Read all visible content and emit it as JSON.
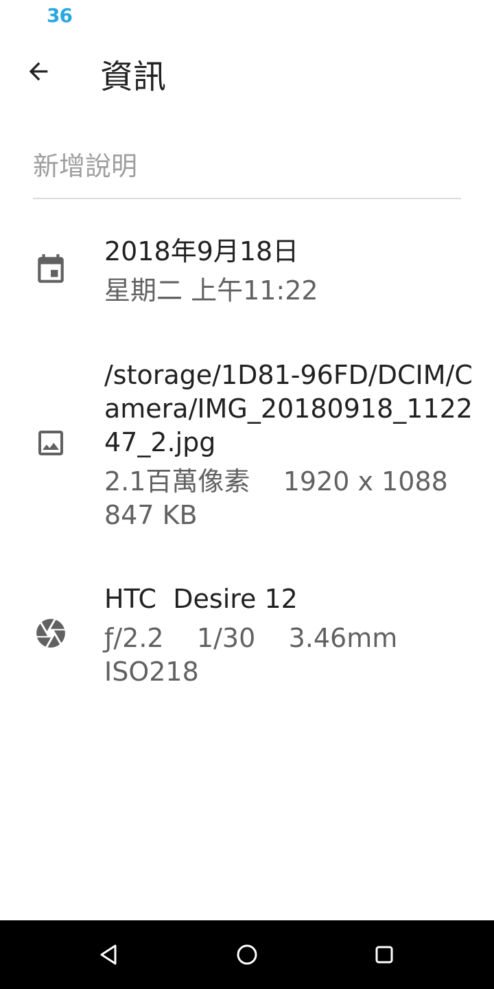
{
  "status_bar": {
    "badge": "36",
    "badge_color": "#29a8e0"
  },
  "app_bar": {
    "back_icon": "arrow-back-icon",
    "title": "資訊"
  },
  "description": {
    "placeholder": "新增說明",
    "value": ""
  },
  "details": {
    "date": {
      "icon": "calendar-icon",
      "primary": "2018年9月18日",
      "secondary": "星期二 上午11:22"
    },
    "file": {
      "icon": "image-icon",
      "path": "/storage/1D81-96FD/DCIM/Camera/IMG_20180918_112247_2.jpg",
      "specs": "2.1百萬像素    1920 x 1088",
      "size": "847 KB"
    },
    "camera": {
      "icon": "camera-aperture-icon",
      "model": "HTC  Desire 12",
      "exposure": "ƒ/2.2    1/30    3.46mm",
      "iso": "ISO218"
    }
  },
  "nav_bar": {
    "back": "nav-back-icon",
    "home": "nav-home-icon",
    "recents": "nav-recents-icon"
  }
}
